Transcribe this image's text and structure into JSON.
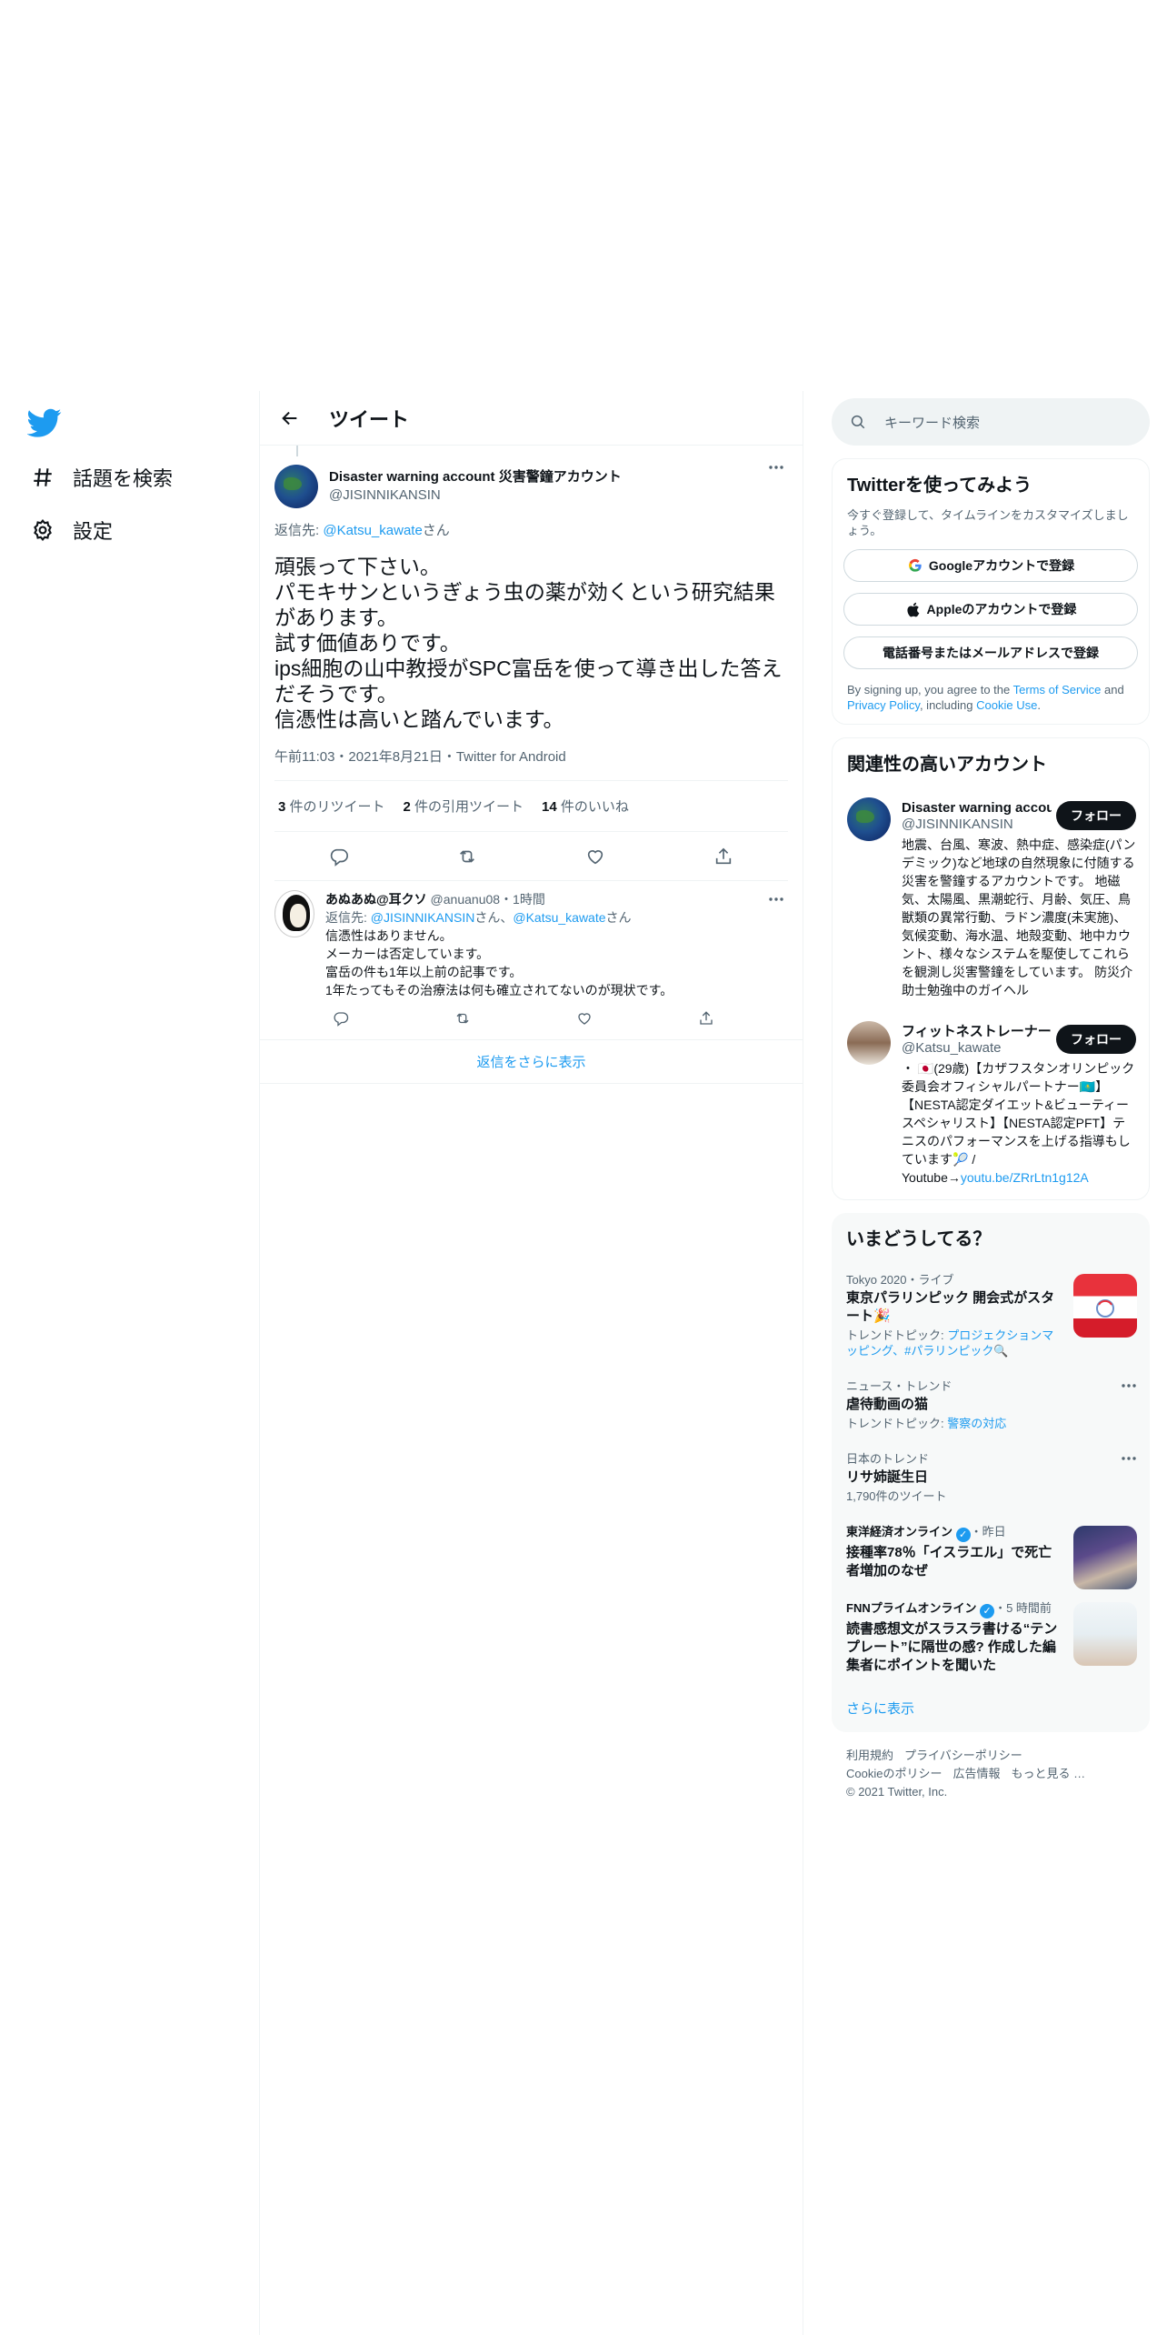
{
  "nav": {
    "explore_label": "話題を検索",
    "settings_label": "設定"
  },
  "header": {
    "title": "ツイート"
  },
  "tweet": {
    "display_name": "Disaster warning account 災害警鐘アカウント",
    "handle": "@JISINNIKANSIN",
    "reply_to_prefix": "返信先: ",
    "reply_to_handle": "@Katsu_kawate",
    "reply_to_suffix": "さん",
    "body": "頑張って下さい。\nパモキサンというぎょう虫の薬が効くという研究結果があります。\n試す価値ありです。\nips細胞の山中教授がSPC富岳を使って導き出した答えだそうです。\n信憑性は高いと踏んでいます。",
    "meta": "午前11:03・2021年8月21日・Twitter for Android",
    "retweets_count": "3",
    "retweets_label": " 件のリツイート",
    "quotes_count": "2",
    "quotes_label": " 件の引用ツイート",
    "likes_count": "14",
    "likes_label": " 件のいいね"
  },
  "reply": {
    "display_name": "あぬあぬ@耳クソ",
    "handle_time": "@anuanu08・1時間",
    "reply_to_prefix": "返信先: ",
    "reply_to_handle1": "@JISINNIKANSIN",
    "reply_to_mid": "さん、",
    "reply_to_handle2": "@Katsu_kawate",
    "reply_to_suffix": "さん",
    "body": "信憑性はありません。\nメーカーは否定しています。\n富岳の件も1年以上前の記事です。\n1年たってもその治療法は何も確立されてないのが現状です。"
  },
  "show_more_replies": "返信をさらに表示",
  "search": {
    "placeholder": "キーワード検索"
  },
  "signup": {
    "title": "Twitterを使ってみよう",
    "subtitle": "今すぐ登録して、タイムラインをカスタマイズしましょう。",
    "google_label": "Googleアカウントで登録",
    "apple_label": "Appleのアカウントで登録",
    "phone_label": "電話番号またはメールアドレスで登録",
    "terms_prefix": "By signing up, you agree to the ",
    "terms_link": "Terms of Service",
    "terms_and": " and ",
    "privacy_link": "Privacy Policy",
    "terms_including": ", including ",
    "cookie_link": "Cookie Use",
    "terms_end": "."
  },
  "relevant": {
    "title": "関連性の高いアカウント",
    "follow_label": "フォロー",
    "accounts": [
      {
        "name": "Disaster warning account 災害警鐘アカウント",
        "handle": "@JISINNIKANSIN",
        "bio": "地震、台風、寒波、熱中症、感染症(パンデミック)など地球の自然現象に付随する災害を警鐘するアカウントです。 地磁気、太陽風、黒潮蛇行、月齢、気圧、鳥獣類の異常行動、ラドン濃度(未実施)、気候変動、海水温、地殻変動、地中カウント、様々なシステムを駆使してこれらを観測し災害警鐘をしています。 防災介助士勉強中のガイヘル"
      },
      {
        "name": "フィットネストレーナー",
        "handle": "@Katsu_kawate",
        "bio": "・ 🇯🇵(29歳)【カザフスタンオリンピック委員会オフィシャルパートナー🇰🇿】【NESTA認定ダイエット&ビューティースペシャリスト】【NESTA認定PFT】テニスのパフォーマンスを上げる指導もしています🎾 / Youtube→",
        "bio_link": "youtu.be/ZRrLtn1g12A"
      }
    ]
  },
  "trends": {
    "title": "いまどうしてる？",
    "items": [
      {
        "context": "Tokyo 2020・ライブ",
        "title": "東京パラリンピック 開会式がスタート🎉",
        "sub_prefix": "トレンドトピック: ",
        "sub_link": "プロジェクションマッピング、#パラリンピック🔍"
      },
      {
        "context": "ニュース・トレンド",
        "title": "虐待動画の猫",
        "sub_prefix": "トレンドトピック: ",
        "sub_link": "警察の対応"
      },
      {
        "context": "日本のトレンド",
        "title": "リサ姉誕生日",
        "sub": "1,790件のツイート"
      },
      {
        "context_name": "東洋経済オンライン",
        "context_time": "・昨日",
        "title": "接種率78％「イスラエル」で死亡者増加のなぜ"
      },
      {
        "context_name": "FNNプライムオンライン",
        "context_time": "・5 時間前",
        "title": "読書感想文がスラスラ書ける“テンプレート”に隔世の感? 作成した編集者にポイントを聞いた"
      }
    ],
    "show_more": "さらに表示"
  },
  "footer": {
    "terms": "利用規約",
    "privacy": "プライバシーポリシー",
    "cookie": "Cookieのポリシー",
    "ads": "広告情報",
    "more": "もっと見る …",
    "copyright": "© 2021 Twitter, Inc."
  },
  "colors": {
    "accent": "#1d9bf0",
    "text": "#0f1419",
    "secondary": "#536471",
    "border": "#eff3f4"
  }
}
